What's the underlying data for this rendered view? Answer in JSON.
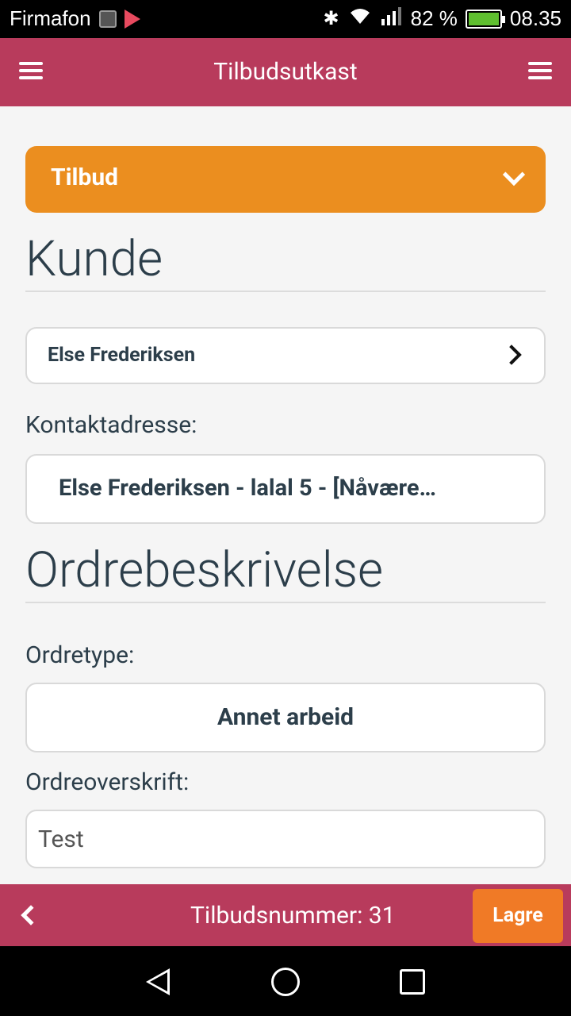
{
  "statusbar": {
    "carrier": "Firmafon",
    "battery": "82 %",
    "time": "08.35",
    "icons": [
      "gallery-icon",
      "play-store-icon",
      "bluetooth-icon",
      "wifi-icon",
      "signal-icon",
      "battery-icon"
    ]
  },
  "appbar": {
    "title": "Tilbudsutkast"
  },
  "accordion": {
    "label": "Tilbud"
  },
  "sections": {
    "customer_title": "Kunde",
    "order_title": "Ordrebeskrivelse"
  },
  "customer": {
    "name": "Else Frederiksen"
  },
  "contact": {
    "label": "Kontaktadresse:",
    "value": "Else Frederiksen - lalal 5 - [Nåvære…"
  },
  "ordertype": {
    "label": "Ordretype:",
    "value": "Annet arbeid"
  },
  "ordertitle": {
    "label": "Ordreoverskrift:",
    "value": "Test"
  },
  "bottombar": {
    "quote_number": "Tilbudsnummer: 31",
    "save_label": "Lagre"
  },
  "colors": {
    "primary": "#b83b5c",
    "accent": "#eb8e1f",
    "save": "#f07a26"
  }
}
